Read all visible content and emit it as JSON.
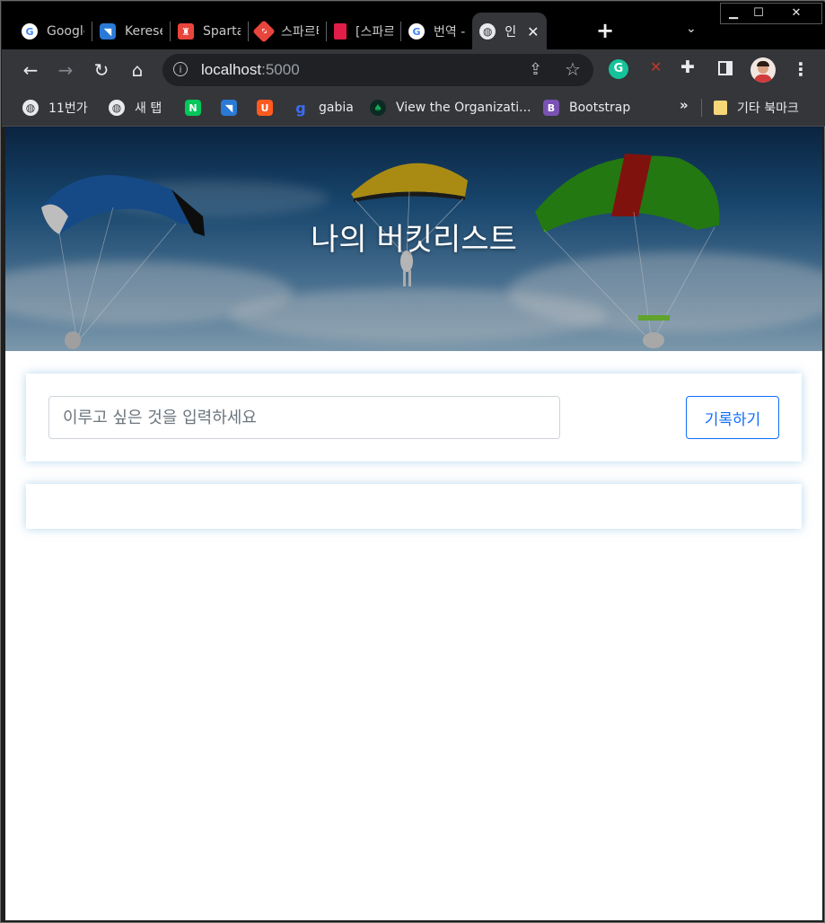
{
  "window": {
    "controls": {
      "minimize": "▁",
      "maximize": "☐",
      "close": "✕"
    }
  },
  "tabs": [
    {
      "title": "Google",
      "favicon": "google-g-icon",
      "color": "#4285f4"
    },
    {
      "title": "Kereses",
      "favicon": "kereses-icon",
      "color": "#2a7ad5"
    },
    {
      "title": "Sparta",
      "favicon": "sparta-icon",
      "color": "#e8453c"
    },
    {
      "title": "스파르타",
      "favicon": "sparta-code-icon",
      "color": "#e8453c"
    },
    {
      "title": "[스파르타",
      "favicon": "notebook-icon",
      "color": "#e11d48"
    },
    {
      "title": "번역 -",
      "favicon": "google-g-icon",
      "color": "#4285f4"
    },
    {
      "title": "인",
      "favicon": "globe-icon",
      "color": "#e8eaed",
      "active": true
    }
  ],
  "address_bar": {
    "host": "localhost",
    "port": ":5000"
  },
  "bookmarks": [
    {
      "label": "11번가",
      "icon": "globe-icon"
    },
    {
      "label": "새 탭",
      "icon": "globe-icon"
    },
    {
      "label": "",
      "icon": "naver-icon",
      "color": "#03c75a",
      "glyph": "N"
    },
    {
      "label": "",
      "icon": "kereses-icon",
      "color": "#2a7ad5",
      "glyph": "◥"
    },
    {
      "label": "",
      "icon": "bag-icon",
      "color": "#ff5a1f",
      "glyph": "U"
    },
    {
      "label": "gabia",
      "icon": "gabia-icon",
      "color": "#1f4bd6",
      "glyph": "g"
    },
    {
      "label": "View the Organizati...",
      "icon": "mongodb-leaf-icon",
      "color": "#13aa52",
      "glyph": "♠"
    },
    {
      "label": "Bootstrap",
      "icon": "bootstrap-icon",
      "color": "#7952b3",
      "glyph": "B"
    }
  ],
  "bookmarks_more": "»",
  "bookmarks_folder": "기타 북마크",
  "page": {
    "hero_title": "나의 버킷리스트",
    "input_placeholder": "이루고 싶은 것을 입력하세요",
    "input_value": "",
    "save_button": "기록하기",
    "bucket_items": []
  }
}
